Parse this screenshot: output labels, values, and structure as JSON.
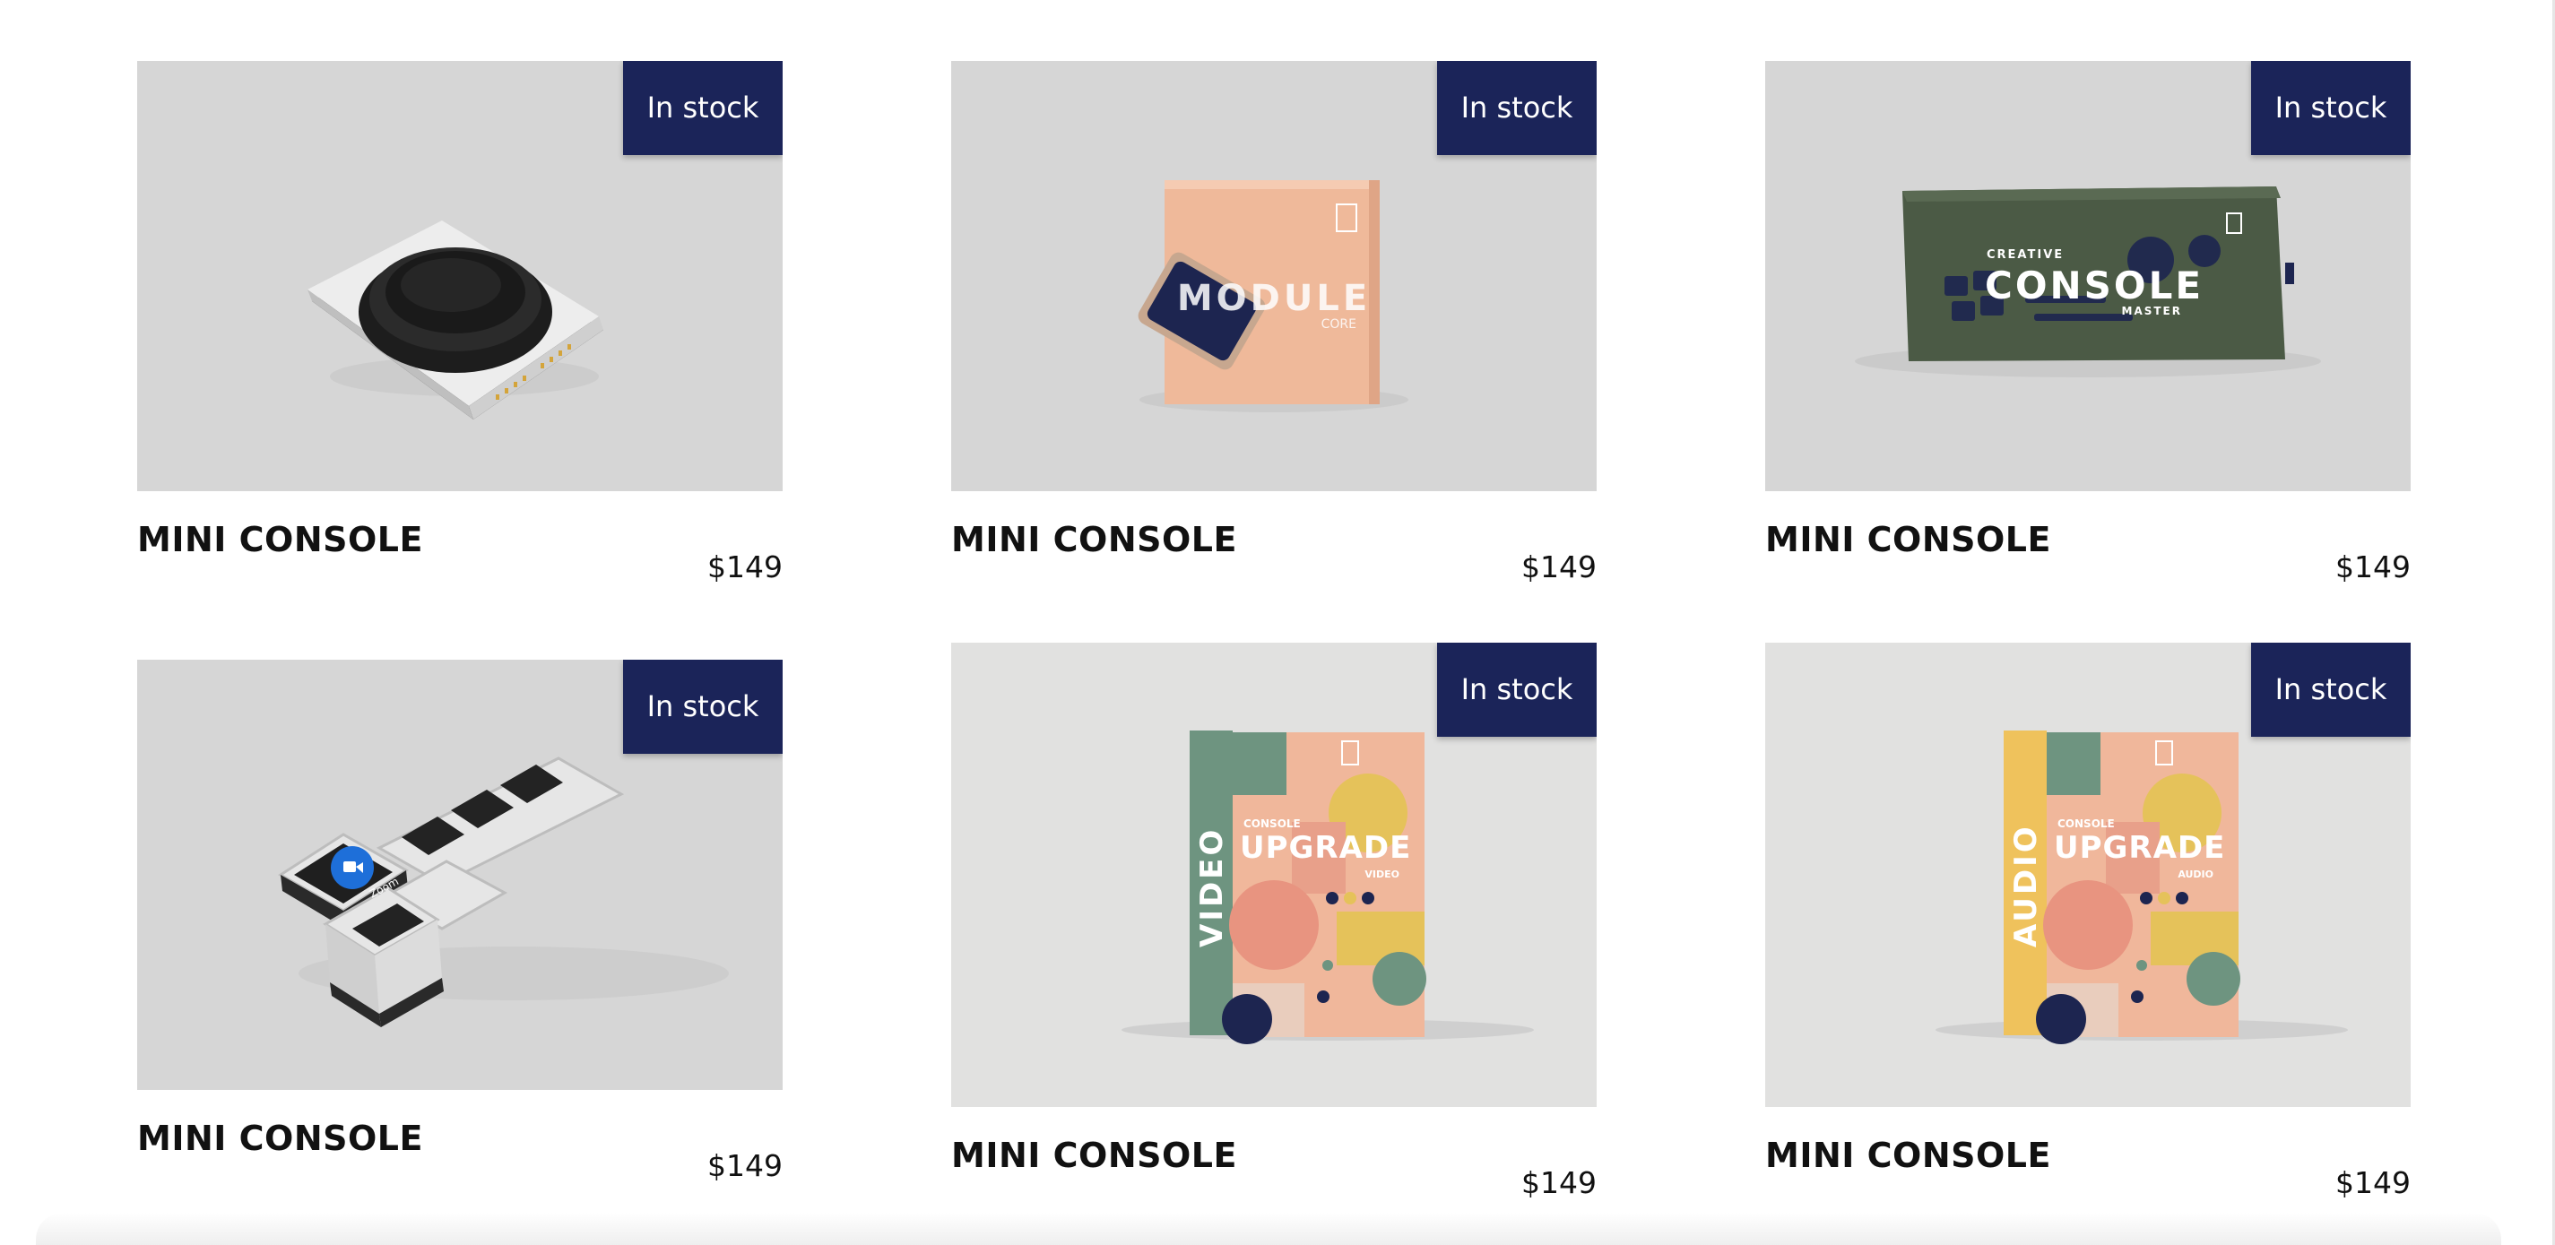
{
  "products": [
    {
      "name": "MINI CONSOLE",
      "price": "$149",
      "badge": "In stock",
      "image": "single-dial-module"
    },
    {
      "name": "MINI CONSOLE",
      "price": "$149",
      "badge": "In stock",
      "image": "module-core-box",
      "box_title": "MODULE",
      "box_sub": "CORE"
    },
    {
      "name": "MINI CONSOLE",
      "price": "$149",
      "badge": "In stock",
      "image": "creative-console-master-box",
      "box_kicker": "CREATIVE",
      "box_title": "CONSOLE",
      "box_sub": "MASTER"
    },
    {
      "name": "MINI CONSOLE",
      "price": "$149",
      "badge": "In stock",
      "image": "zoom-key-modules",
      "key_label": "Zoom"
    },
    {
      "name": "MINI CONSOLE",
      "price": "$149",
      "badge": "In stock",
      "image": "console-upgrade-video-box",
      "spine": "VIDEO",
      "box_kicker": "CONSOLE",
      "box_title": "UPGRADE",
      "box_sub": "VIDEO"
    },
    {
      "name": "MINI CONSOLE",
      "price": "$149",
      "badge": "In stock",
      "image": "console-upgrade-audio-box",
      "spine": "AUDIO",
      "box_kicker": "CONSOLE",
      "box_title": "UPGRADE",
      "box_sub": "AUDIO"
    }
  ],
  "colors": {
    "badge_bg": "#1b2459",
    "image_bg": "#d6d6d6",
    "image_bg_light": "#e1e1e0",
    "text": "#111111"
  }
}
